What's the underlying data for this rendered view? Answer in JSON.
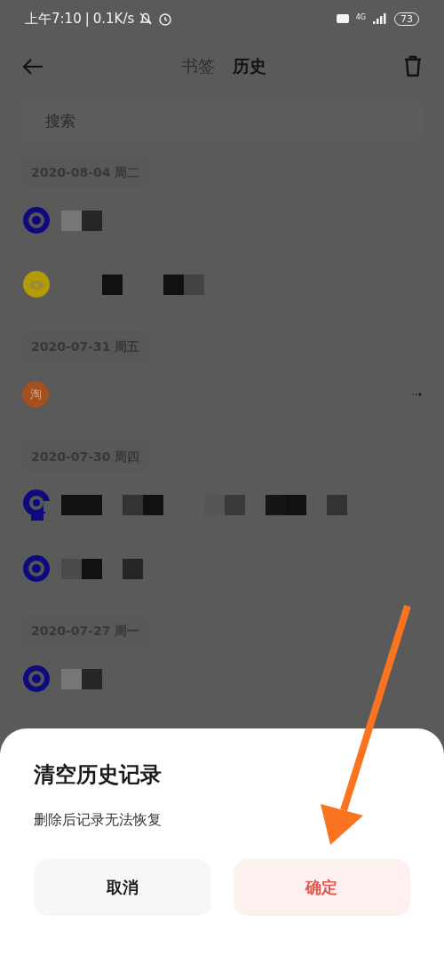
{
  "status_bar": {
    "time": "上午7:10",
    "separator": "|",
    "speed": "0.1K/s",
    "network": "4G",
    "battery": "73"
  },
  "header": {
    "tabs": [
      {
        "label": "书签",
        "selected": false
      },
      {
        "label": "历史",
        "selected": true
      }
    ]
  },
  "search": {
    "placeholder": "搜索"
  },
  "history": [
    {
      "date": "2020-08-04 周二",
      "items": [
        {
          "kind": "target",
          "redacted": true,
          "more": false
        },
        {
          "kind": "eye",
          "redacted": true,
          "more": false
        }
      ]
    },
    {
      "date": "2020-07-31 周五",
      "items": [
        {
          "kind": "tao",
          "icon_text": "淘",
          "redacted": false,
          "more": true
        }
      ]
    },
    {
      "date": "2020-07-30 周四",
      "items": [
        {
          "kind": "spiral",
          "redacted": true,
          "more": false
        },
        {
          "kind": "target",
          "redacted": true,
          "more": false
        }
      ]
    },
    {
      "date": "2020-07-27 周一",
      "items": [
        {
          "kind": "target",
          "redacted": true,
          "more": false
        }
      ]
    }
  ],
  "dialog": {
    "title": "清空历史记录",
    "message": "删除后记录无法恢复",
    "buttons": [
      {
        "label": "取消",
        "kind": "cancel"
      },
      {
        "label": "确定",
        "kind": "confirm"
      }
    ]
  },
  "annotation": {
    "kind": "arrow"
  }
}
